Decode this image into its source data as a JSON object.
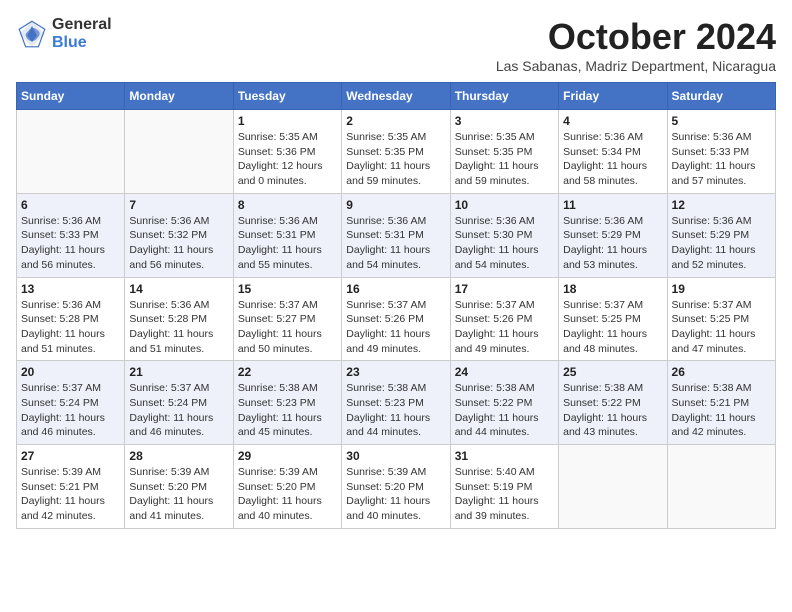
{
  "header": {
    "logo_general": "General",
    "logo_blue": "Blue",
    "month_title": "October 2024",
    "subtitle": "Las Sabanas, Madriz Department, Nicaragua"
  },
  "weekdays": [
    "Sunday",
    "Monday",
    "Tuesday",
    "Wednesday",
    "Thursday",
    "Friday",
    "Saturday"
  ],
  "weeks": [
    [
      {
        "day": "",
        "info": ""
      },
      {
        "day": "",
        "info": ""
      },
      {
        "day": "1",
        "info": "Sunrise: 5:35 AM\nSunset: 5:36 PM\nDaylight: 12 hours\nand 0 minutes."
      },
      {
        "day": "2",
        "info": "Sunrise: 5:35 AM\nSunset: 5:35 PM\nDaylight: 11 hours\nand 59 minutes."
      },
      {
        "day": "3",
        "info": "Sunrise: 5:35 AM\nSunset: 5:35 PM\nDaylight: 11 hours\nand 59 minutes."
      },
      {
        "day": "4",
        "info": "Sunrise: 5:36 AM\nSunset: 5:34 PM\nDaylight: 11 hours\nand 58 minutes."
      },
      {
        "day": "5",
        "info": "Sunrise: 5:36 AM\nSunset: 5:33 PM\nDaylight: 11 hours\nand 57 minutes."
      }
    ],
    [
      {
        "day": "6",
        "info": "Sunrise: 5:36 AM\nSunset: 5:33 PM\nDaylight: 11 hours\nand 56 minutes."
      },
      {
        "day": "7",
        "info": "Sunrise: 5:36 AM\nSunset: 5:32 PM\nDaylight: 11 hours\nand 56 minutes."
      },
      {
        "day": "8",
        "info": "Sunrise: 5:36 AM\nSunset: 5:31 PM\nDaylight: 11 hours\nand 55 minutes."
      },
      {
        "day": "9",
        "info": "Sunrise: 5:36 AM\nSunset: 5:31 PM\nDaylight: 11 hours\nand 54 minutes."
      },
      {
        "day": "10",
        "info": "Sunrise: 5:36 AM\nSunset: 5:30 PM\nDaylight: 11 hours\nand 54 minutes."
      },
      {
        "day": "11",
        "info": "Sunrise: 5:36 AM\nSunset: 5:29 PM\nDaylight: 11 hours\nand 53 minutes."
      },
      {
        "day": "12",
        "info": "Sunrise: 5:36 AM\nSunset: 5:29 PM\nDaylight: 11 hours\nand 52 minutes."
      }
    ],
    [
      {
        "day": "13",
        "info": "Sunrise: 5:36 AM\nSunset: 5:28 PM\nDaylight: 11 hours\nand 51 minutes."
      },
      {
        "day": "14",
        "info": "Sunrise: 5:36 AM\nSunset: 5:28 PM\nDaylight: 11 hours\nand 51 minutes."
      },
      {
        "day": "15",
        "info": "Sunrise: 5:37 AM\nSunset: 5:27 PM\nDaylight: 11 hours\nand 50 minutes."
      },
      {
        "day": "16",
        "info": "Sunrise: 5:37 AM\nSunset: 5:26 PM\nDaylight: 11 hours\nand 49 minutes."
      },
      {
        "day": "17",
        "info": "Sunrise: 5:37 AM\nSunset: 5:26 PM\nDaylight: 11 hours\nand 49 minutes."
      },
      {
        "day": "18",
        "info": "Sunrise: 5:37 AM\nSunset: 5:25 PM\nDaylight: 11 hours\nand 48 minutes."
      },
      {
        "day": "19",
        "info": "Sunrise: 5:37 AM\nSunset: 5:25 PM\nDaylight: 11 hours\nand 47 minutes."
      }
    ],
    [
      {
        "day": "20",
        "info": "Sunrise: 5:37 AM\nSunset: 5:24 PM\nDaylight: 11 hours\nand 46 minutes."
      },
      {
        "day": "21",
        "info": "Sunrise: 5:37 AM\nSunset: 5:24 PM\nDaylight: 11 hours\nand 46 minutes."
      },
      {
        "day": "22",
        "info": "Sunrise: 5:38 AM\nSunset: 5:23 PM\nDaylight: 11 hours\nand 45 minutes."
      },
      {
        "day": "23",
        "info": "Sunrise: 5:38 AM\nSunset: 5:23 PM\nDaylight: 11 hours\nand 44 minutes."
      },
      {
        "day": "24",
        "info": "Sunrise: 5:38 AM\nSunset: 5:22 PM\nDaylight: 11 hours\nand 44 minutes."
      },
      {
        "day": "25",
        "info": "Sunrise: 5:38 AM\nSunset: 5:22 PM\nDaylight: 11 hours\nand 43 minutes."
      },
      {
        "day": "26",
        "info": "Sunrise: 5:38 AM\nSunset: 5:21 PM\nDaylight: 11 hours\nand 42 minutes."
      }
    ],
    [
      {
        "day": "27",
        "info": "Sunrise: 5:39 AM\nSunset: 5:21 PM\nDaylight: 11 hours\nand 42 minutes."
      },
      {
        "day": "28",
        "info": "Sunrise: 5:39 AM\nSunset: 5:20 PM\nDaylight: 11 hours\nand 41 minutes."
      },
      {
        "day": "29",
        "info": "Sunrise: 5:39 AM\nSunset: 5:20 PM\nDaylight: 11 hours\nand 40 minutes."
      },
      {
        "day": "30",
        "info": "Sunrise: 5:39 AM\nSunset: 5:20 PM\nDaylight: 11 hours\nand 40 minutes."
      },
      {
        "day": "31",
        "info": "Sunrise: 5:40 AM\nSunset: 5:19 PM\nDaylight: 11 hours\nand 39 minutes."
      },
      {
        "day": "",
        "info": ""
      },
      {
        "day": "",
        "info": ""
      }
    ]
  ]
}
